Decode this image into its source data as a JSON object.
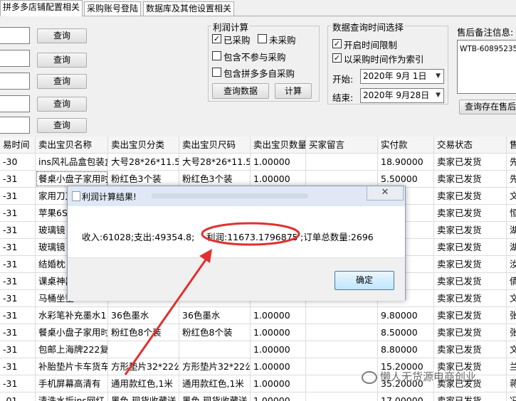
{
  "tabs": [
    "拼多多店铺配置相关",
    "采购账号登陆",
    "数据库及其他设置相关"
  ],
  "query_label": "查询",
  "profit": {
    "title": "利润计算",
    "purchased": "已采购",
    "not_purchased": "未采购",
    "exclude_others": "包含不参与采购",
    "include_self": "包含拼多多自采购",
    "query_btn": "查询数据",
    "calc_btn": "计算"
  },
  "time": {
    "title": "数据查询时间选择",
    "limit": "开启时间限制",
    "use_purchase_time": "以采购时间作为索引",
    "start_label": "开始:",
    "end_label": "结束:",
    "start_date": "2020年 9月 1日",
    "end_date": "2020年 9月28日"
  },
  "remark": {
    "title": "售后备注信息:",
    "value": "WTB-608952350",
    "btn": "查询存在售后"
  },
  "table": {
    "headers": [
      "易时间",
      "卖出宝贝名称",
      "卖出宝贝分类",
      "卖出宝贝尺码",
      "卖出宝贝数量",
      "买家留言",
      "实付款",
      "交易状态",
      "售"
    ],
    "rows": [
      [
        "-30",
        "ins风礼品盒包装盒",
        "大号28*26*11.5c",
        "大号28*26*11.5c",
        "1.00000",
        "",
        "18.90000",
        "卖家已发货",
        "先"
      ],
      [
        "-31",
        "餐桌小盘子家用时",
        "粉红色3个装",
        "粉红色3个装",
        "1.00000",
        "",
        "5.50000",
        "卖家已发货",
        "先"
      ],
      [
        "-31",
        "家用刀叉",
        "",
        "",
        "",
        "",
        "",
        "卖家已发货",
        "文"
      ],
      [
        "-31",
        "苹果6S",
        "",
        "",
        "",
        "",
        "",
        "卖家已发货",
        "恒"
      ],
      [
        "-31",
        "玻璃镜",
        "",
        "",
        "",
        "",
        "",
        "卖家已发货",
        "湖"
      ],
      [
        "-31",
        "玻璃镜",
        "",
        "",
        "",
        "",
        "",
        "卖家已发货",
        "湖"
      ],
      [
        "-31",
        "结婚枕",
        "",
        "",
        "",
        "",
        "",
        "卖家已发货",
        "汝"
      ],
      [
        "-31",
        "课桌神器",
        "",
        "",
        "",
        "",
        "",
        "卖家已发货",
        "倩"
      ],
      [
        "-31",
        "马桶坐垫",
        "",
        "",
        "",
        "",
        "",
        "卖家已发货",
        "文"
      ],
      [
        "-31",
        "水彩笔补充墨水1",
        "36色墨水",
        "36色墨水",
        "1.00000",
        "",
        "9.80000",
        "卖家已发货",
        "张"
      ],
      [
        "-31",
        "餐桌小盘子家用时",
        "粉红色8个装",
        "粉红色8个装",
        "1.00000",
        "",
        "8.50000",
        "卖家已发货",
        "张"
      ],
      [
        "-31",
        "包邮上海牌222复",
        "",
        "",
        "1.00000",
        "",
        "8.80000",
        "卖家已发货",
        "文"
      ],
      [
        "-31",
        "补胎垫片卡车货车",
        "方形垫片32*22公",
        "方形垫片32*22公",
        "1.00000",
        "",
        "15.20000",
        "卖家已发货",
        "兰"
      ],
      [
        "-31",
        "手机屏幕高清有",
        "通用款红色,1米",
        "通用款红色,1米",
        "1.00000",
        "",
        "35.20000",
        "卖家已发货",
        "蒋"
      ],
      [
        "-01",
        "清洗水垢ins网红",
        "黑色 现货收藏送",
        "黑色 现货收藏送",
        "1.00000",
        "",
        "17.00000",
        "卖家已发货",
        "冯"
      ]
    ]
  },
  "dialog": {
    "title": "利润计算结果!",
    "message": "收入:61028;支出:49354.8;",
    "profit_text": "利润:11673.1796875",
    "tail": ";订单总数量:2696",
    "ok": "确定"
  },
  "watermark": "懒人无货源电商创业",
  "colors": {
    "highlight": "#e0312f",
    "dialog_border": "#8a9bb5"
  }
}
